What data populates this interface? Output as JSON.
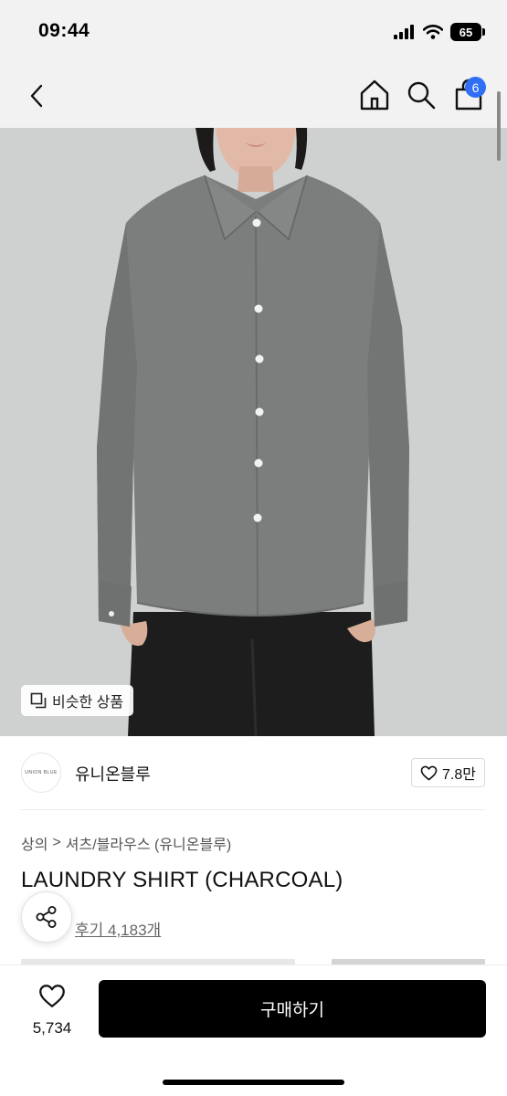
{
  "status_bar": {
    "time": "09:44",
    "battery": "65",
    "icons": [
      "signal-icon",
      "wifi-icon",
      "battery-icon"
    ]
  },
  "nav": {
    "icons": [
      "back-icon",
      "home-icon",
      "search-icon",
      "cart-icon"
    ],
    "cart_count": "6"
  },
  "hero": {
    "similar_label": "비슷한 상품",
    "similar_icon": "copy-icon"
  },
  "brand": {
    "logo_text": "UNION BLUE",
    "name": "유니온블루",
    "likes": "7.8만",
    "like_icon": "heart-icon"
  },
  "breadcrumb": {
    "items": [
      "상의",
      "셔츠/블라우스 (유니온블루)"
    ],
    "separator": ">"
  },
  "product": {
    "title": "LAUNDRY SHIRT (CHARCOAL)",
    "review_link": "후기 4,183개",
    "share_icon": "share-icon"
  },
  "bottom_bar": {
    "wish_count": "5,734",
    "buy_label": "구매하기"
  },
  "colors": {
    "badge": "#2f6ef5",
    "buy_button": "#000000",
    "header_bg": "#f2f2f2",
    "shirt": "#7c7d7d",
    "backdrop": "#cfd0d0"
  }
}
